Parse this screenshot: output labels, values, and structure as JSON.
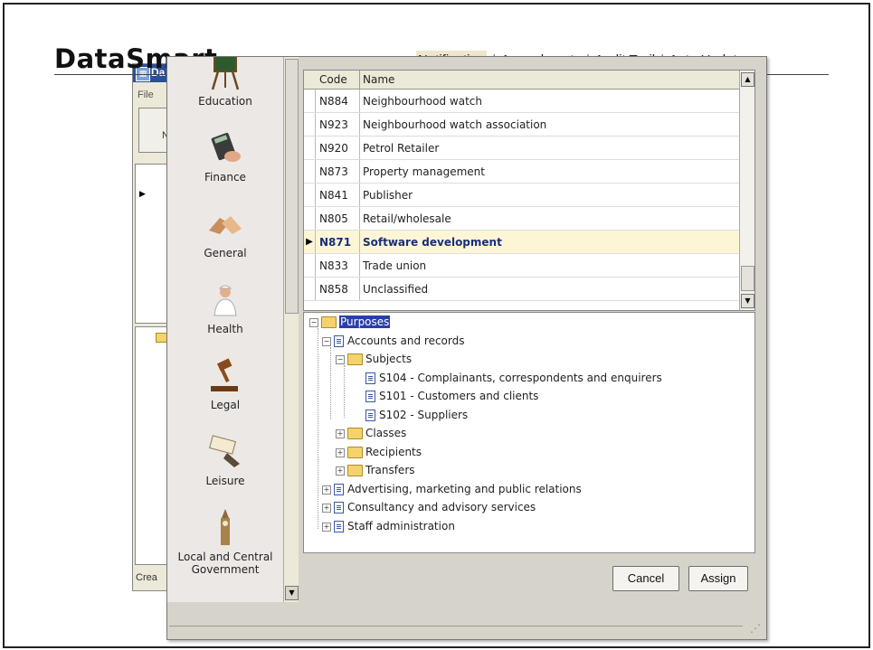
{
  "brand": {
    "name": "DataSmart"
  },
  "top_nav": {
    "items": [
      "Notification",
      "Amendments",
      "Audit Trail",
      "Auto Update"
    ],
    "active": "Notification",
    "separator": "|"
  },
  "background_window": {
    "title": "Da",
    "menu_file": "File",
    "button_text": "N",
    "status_text": "Crea"
  },
  "categories": [
    {
      "label": "Education",
      "icon": "easel-icon"
    },
    {
      "label": "Finance",
      "icon": "calculator-icon"
    },
    {
      "label": "General",
      "icon": "handshake-icon"
    },
    {
      "label": "Health",
      "icon": "nurse-icon"
    },
    {
      "label": "Legal",
      "icon": "gavel-icon"
    },
    {
      "label": "Leisure",
      "icon": "ticket-icon"
    },
    {
      "label": "Local and Central Government",
      "label_line1": "Local and Central",
      "label_line2": "Government",
      "icon": "big-ben-icon"
    }
  ],
  "grid": {
    "columns": [
      "Code",
      "Name"
    ],
    "rows": [
      {
        "code": "N884",
        "name": "Neighbourhood watch"
      },
      {
        "code": "N923",
        "name": "Neighbourhood watch association"
      },
      {
        "code": "N920",
        "name": "Petrol Retailer"
      },
      {
        "code": "N873",
        "name": "Property management"
      },
      {
        "code": "N841",
        "name": "Publisher"
      },
      {
        "code": "N805",
        "name": "Retail/wholesale"
      },
      {
        "code": "N871",
        "name": "Software development"
      },
      {
        "code": "N833",
        "name": "Trade union"
      },
      {
        "code": "N858",
        "name": "Unclassified"
      }
    ],
    "selected_code": "N871"
  },
  "tree": {
    "root": "Purposes",
    "nodes": [
      {
        "label": "Accounts and records"
      },
      {
        "label": "Subjects"
      },
      {
        "label": "S104 - Complainants, correspondents and enquirers"
      },
      {
        "label": "S101 - Customers and clients"
      },
      {
        "label": "S102 - Suppliers"
      },
      {
        "label": "Classes"
      },
      {
        "label": "Recipients"
      },
      {
        "label": "Transfers"
      },
      {
        "label": "Advertising, marketing and public relations"
      },
      {
        "label": "Consultancy and advisory services"
      },
      {
        "label": "Staff administration"
      }
    ]
  },
  "buttons": {
    "cancel": "Cancel",
    "assign": "Assign"
  },
  "colors": {
    "selected_row_bg": "#fdf6d6",
    "selected_row_text": "#1a2f7a",
    "tree_selection": "#2b3fa8",
    "dialog_bg": "#d6d3ca"
  }
}
